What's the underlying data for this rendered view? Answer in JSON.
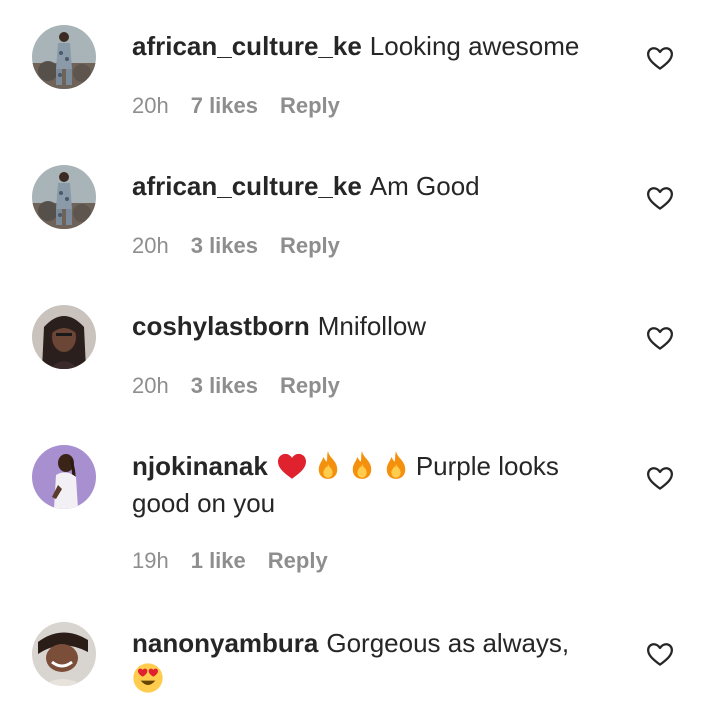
{
  "comments": [
    {
      "username": "african_culture_ke",
      "text": "Looking awesome",
      "time": "20h",
      "likes": "7 likes",
      "reply": "Reply",
      "avatar": "avatar-person-rocks"
    },
    {
      "username": "african_culture_ke",
      "text": "Am Good",
      "time": "20h",
      "likes": "3 likes",
      "reply": "Reply",
      "avatar": "avatar-person-rocks"
    },
    {
      "username": "coshylastborn",
      "text": "Mnifollow",
      "time": "20h",
      "likes": "3 likes",
      "reply": "Reply",
      "avatar": "avatar-woman-braids"
    },
    {
      "username": "njokinanak",
      "emojis": [
        "red-heart-emoji",
        "fire-emoji",
        "fire-emoji",
        "fire-emoji"
      ],
      "text": "Purple looks good on you",
      "time": "19h",
      "likes": "1 like",
      "reply": "Reply",
      "avatar": "avatar-woman-purple-bg"
    },
    {
      "username": "nanonyambura",
      "text": "Gorgeous as always,",
      "emojis_after": [
        "heart-eyes-emoji"
      ],
      "avatar": "avatar-woman-smiling"
    }
  ],
  "icons": {
    "like": "heart-outline-icon"
  },
  "colors": {
    "text": "#262626",
    "secondary": "#8e8e8e",
    "heart_red": "#e0212e",
    "fire_orange": "#f4900c"
  }
}
